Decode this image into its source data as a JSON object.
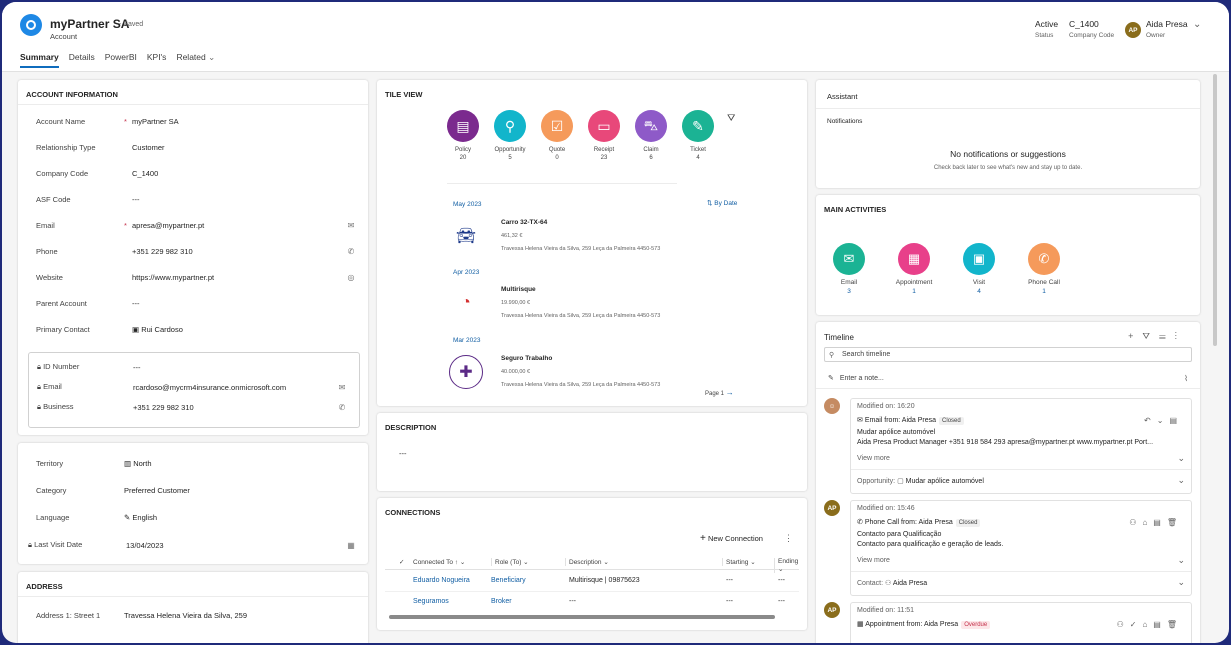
{
  "header": {
    "title": "myPartner SA",
    "saved": "- Saved",
    "entity": "Account",
    "status_value": "Active",
    "status_label": "Status",
    "code_value": "C_1400",
    "code_label": "Company Code",
    "owner_initials": "AP",
    "owner_name": "Aida Presa",
    "owner_label": "Owner",
    "tabs": [
      "Summary",
      "Details",
      "PowerBI",
      "KPI's",
      "Related"
    ]
  },
  "account_info": {
    "title": "ACCOUNT INFORMATION",
    "fields": [
      {
        "label": "Account Name",
        "value": "myPartner SA"
      },
      {
        "label": "Relationship Type",
        "value": "Customer"
      },
      {
        "label": "Company Code",
        "value": "C_1400"
      },
      {
        "label": "ASF Code",
        "value": "---"
      },
      {
        "label": "Email",
        "value": "apresa@mypartner.pt"
      },
      {
        "label": "Phone",
        "value": "+351 229 982 310"
      },
      {
        "label": "Website",
        "value": "https://www.mypartner.pt"
      },
      {
        "label": "Parent Account",
        "value": "---"
      },
      {
        "label": "Primary Contact",
        "value": "Rui Cardoso"
      }
    ],
    "contact_card": [
      {
        "label": "ID Number",
        "value": "---"
      },
      {
        "label": "Email",
        "value": "rcardoso@mycrm4insurance.onmicrosoft.com"
      },
      {
        "label": "Business",
        "value": "+351 229 982 310"
      }
    ]
  },
  "classification": {
    "fields": [
      {
        "label": "Territory",
        "value": "North"
      },
      {
        "label": "Category",
        "value": "Preferred Customer"
      },
      {
        "label": "Language",
        "value": "English"
      },
      {
        "label": "Last Visit Date",
        "value": "13/04/2023"
      }
    ]
  },
  "address": {
    "title": "ADDRESS",
    "street_label": "Address 1: Street 1",
    "street_value": "Travessa Helena Vieira da Silva, 259"
  },
  "tile_view": {
    "title": "TILE VIEW",
    "tiles": [
      {
        "name": "Policy",
        "count": "20",
        "color": "#7b2a8e"
      },
      {
        "name": "Opportunity",
        "count": "5",
        "color": "#12b5cb"
      },
      {
        "name": "Quote",
        "count": "0",
        "color": "#f59a5b"
      },
      {
        "name": "Receipt",
        "count": "23",
        "color": "#e8487a"
      },
      {
        "name": "Claim",
        "count": "6",
        "color": "#8e5ac8"
      },
      {
        "name": "Ticket",
        "count": "4",
        "color": "#1bb394"
      }
    ],
    "sort_label": "By Date",
    "months": [
      "May 2023",
      "Apr 2023",
      "Mar 2023"
    ],
    "items": [
      {
        "title": "Carro 32-TX-64",
        "price": "461,32 €",
        "address": "Travessa Helena Vieira da Silva, 259 Leça da Palmeira 4450-573"
      },
      {
        "title": "Multirisque",
        "price": "19.990,00 €",
        "address": "Travessa Helena Vieira da Silva, 259 Leça da Palmeira 4450-573"
      },
      {
        "title": "Seguro Trabalho",
        "price": "40.000,00 €",
        "address": "Travessa Helena Vieira da Silva, 259 Leça da Palmeira 4450-573"
      }
    ],
    "page": "Page 1"
  },
  "description": {
    "title": "DESCRIPTION",
    "value": "---"
  },
  "connections": {
    "title": "CONNECTIONS",
    "new_label": "New Connection",
    "columns": [
      "Connected To",
      "Role (To)",
      "Description",
      "Starting",
      "Ending"
    ],
    "rows": [
      {
        "to": "Eduardo Nogueira",
        "role": "Beneficiary",
        "desc": "Multirisque | 09875623",
        "start": "---",
        "end": "---"
      },
      {
        "to": "Seguramos",
        "role": "Broker",
        "desc": "---",
        "start": "---",
        "end": "---"
      }
    ]
  },
  "assistant": {
    "title": "Assistant",
    "sub": "Notifications",
    "empty_title": "No notifications or suggestions",
    "empty_sub": "Check back later to see what's new and stay up to date."
  },
  "activities": {
    "title": "MAIN ACTIVITIES",
    "items": [
      {
        "name": "Email",
        "count": "3",
        "color": "#1bb394"
      },
      {
        "name": "Appointment",
        "count": "1",
        "color": "#e8408a"
      },
      {
        "name": "Visit",
        "count": "4",
        "color": "#12b5cb"
      },
      {
        "name": "Phone Call",
        "count": "1",
        "color": "#f59a5b"
      }
    ]
  },
  "timeline": {
    "title": "Timeline",
    "search_placeholder": "Search timeline",
    "note_placeholder": "Enter a note...",
    "entries": [
      {
        "modified": "Modified on: 16:20",
        "head": "Email from: Aida Presa",
        "status": "Closed",
        "line1": "Mudar apólice automóvel",
        "line2": "Aida Presa   Product Manager +351 918 584 293 apresa@mypartner.pt www.mypartner.pt     Port...",
        "more": "View more",
        "related_label": "Opportunity:",
        "related_value": "Mudar apólice automóvel"
      },
      {
        "modified": "Modified on: 15:46",
        "initials": "AP",
        "head": "Phone Call from: Aida Presa",
        "status": "Closed",
        "line1": "Contacto para Qualificação",
        "line2": "Contacto para qualificação e geração de leads.",
        "more": "View more",
        "related_label": "Contact:",
        "related_value": "Aida Presa"
      },
      {
        "modified": "Modified on: 11:51",
        "initials": "AP",
        "head": "Appointment from: Aida Presa",
        "status": "Overdue"
      }
    ]
  }
}
